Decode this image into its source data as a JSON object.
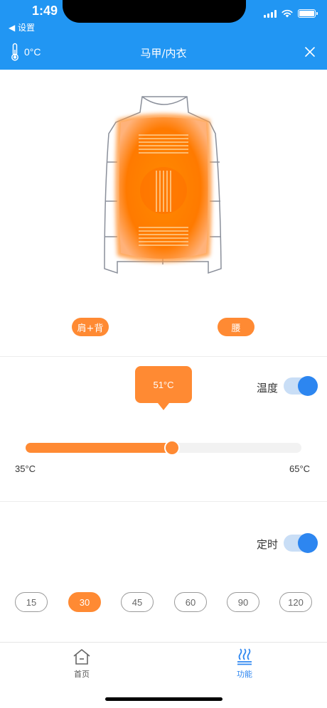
{
  "status_bar": {
    "time": "1:49",
    "back_label": "◀ 设置"
  },
  "nav": {
    "temperature": "0°C",
    "title": "马甲/内衣"
  },
  "zones": {
    "shoulder_back": "肩+背",
    "waist": "腰"
  },
  "temperature": {
    "label": "温度",
    "current": "51°C",
    "min_label": "35°C",
    "max_label": "65°C",
    "value_fraction": 0.53,
    "enabled": true
  },
  "timer": {
    "label": "定时",
    "enabled": true,
    "options": [
      "15",
      "30",
      "45",
      "60",
      "90",
      "120"
    ],
    "selected": "30"
  },
  "tabs": [
    {
      "label": "首页",
      "icon": "home-icon",
      "active": false
    },
    {
      "label": "功能",
      "icon": "heat-waves-icon",
      "active": true
    }
  ],
  "colors": {
    "primary_blue": "#2196F3",
    "accent_orange": "#FF8A33",
    "toggle_knob": "#2D86F0"
  }
}
